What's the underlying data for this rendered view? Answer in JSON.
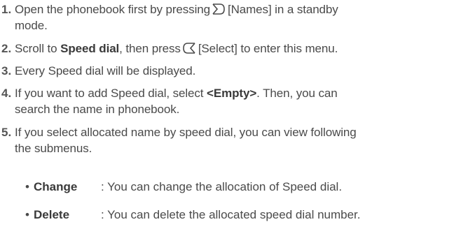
{
  "steps": [
    {
      "num": "1.",
      "pre": "Open the phonebook first by pressing",
      "icon": "right-softkey-icon",
      "post": "[Names] in a standby",
      "line2": "mode."
    },
    {
      "num": "2.",
      "pre": "Scroll to",
      "bold": "Speed dial",
      "mid": ", then press",
      "icon": "left-softkey-icon",
      "post": "[Select] to enter this menu."
    },
    {
      "num": "3.",
      "text": "Every Speed dial will be displayed."
    },
    {
      "num": "4.",
      "pre": "If you want to add Speed dial, select",
      "bold": "<Empty>",
      "post": ". Then, you can",
      "line2": "search the name in phonebook."
    },
    {
      "num": "5.",
      "text": "If you select allocated name by speed dial, you can view following",
      "line2": "the submenus."
    }
  ],
  "submenus": [
    {
      "bullet": "•",
      "term": "Change",
      "desc": ": You can change the allocation of Speed dial."
    },
    {
      "bullet": "•",
      "term": "Delete",
      "desc": ": You can delete the allocated speed dial number."
    }
  ]
}
